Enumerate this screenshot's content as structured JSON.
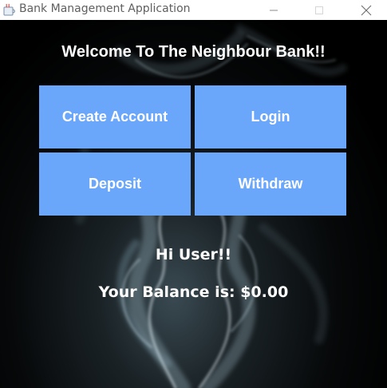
{
  "window": {
    "title": "Bank Management Application",
    "controls": {
      "minimize_icon": "minimize-icon",
      "maximize_icon": "maximize-icon",
      "close_icon": "close-icon"
    }
  },
  "main": {
    "welcome": "Welcome To The Neighbour Bank!!",
    "buttons": {
      "create_account": "Create Account",
      "login": "Login",
      "deposit": "Deposit",
      "withdraw": "Withdraw"
    },
    "greeting": "Hi User!!",
    "balance_text": "Your Balance is: $0.00"
  },
  "colors": {
    "button_bg": "#6aa7fb",
    "text": "#ffffff",
    "background": "#000000"
  }
}
